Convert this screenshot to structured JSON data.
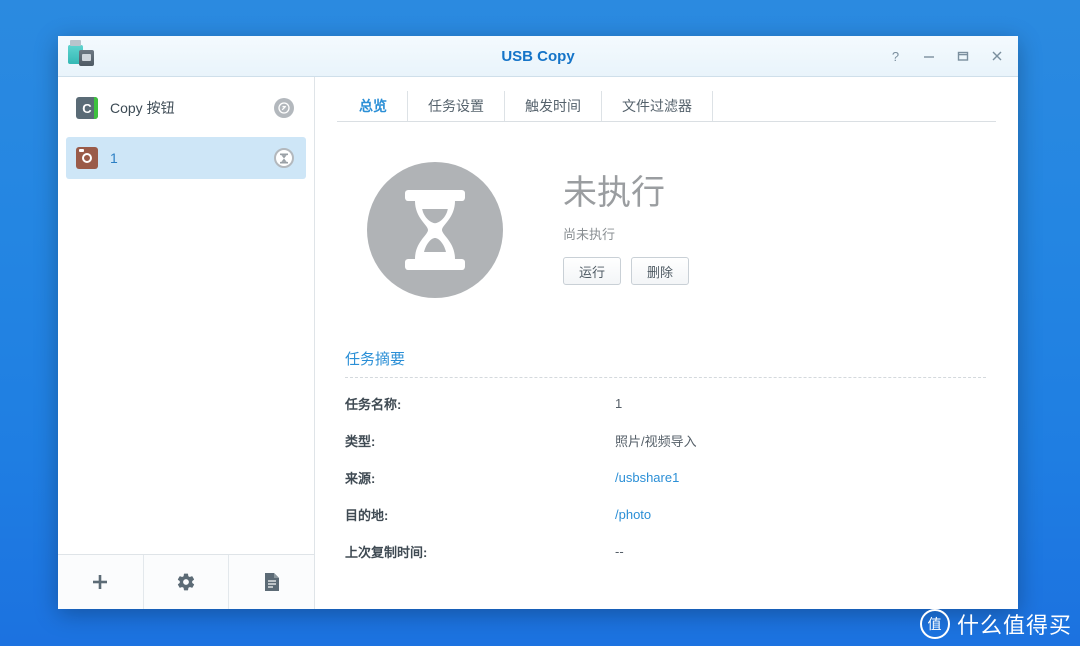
{
  "window": {
    "title": "USB Copy",
    "app_icon": "usb-sd-icon",
    "controls": [
      {
        "name": "help-button",
        "glyph": "?"
      },
      {
        "name": "minimize-button",
        "glyph": "minimize-icon"
      },
      {
        "name": "maximize-button",
        "glyph": "maximize-icon"
      },
      {
        "name": "close-button",
        "glyph": "close-icon"
      }
    ]
  },
  "sidebar": {
    "tasks": [
      {
        "label": "Copy 按钮",
        "icon": "copy-button-icon",
        "status_icon": "link-broken-icon",
        "selected": false
      },
      {
        "label": "1",
        "icon": "camera-icon",
        "status_icon": "hourglass-icon",
        "selected": true
      }
    ],
    "toolbar": [
      {
        "name": "add-task-button",
        "icon": "plus-icon"
      },
      {
        "name": "settings-button",
        "icon": "gear-icon"
      },
      {
        "name": "log-button",
        "icon": "document-icon"
      }
    ]
  },
  "main": {
    "tabs": [
      {
        "label": "总览",
        "active": true
      },
      {
        "label": "任务设置",
        "active": false
      },
      {
        "label": "触发时间",
        "active": false
      },
      {
        "label": "文件过滤器",
        "active": false
      }
    ],
    "status": {
      "icon": "hourglass-icon",
      "title": "未执行",
      "subtitle": "尚未执行",
      "run_label": "运行",
      "delete_label": "删除"
    },
    "summary": {
      "title": "任务摘要",
      "rows": [
        {
          "key": "任务名称:",
          "value": "1",
          "link": false
        },
        {
          "key": "类型:",
          "value": "照片/视频导入",
          "link": false
        },
        {
          "key": "来源:",
          "value": "/usbshare1",
          "link": true
        },
        {
          "key": "目的地:",
          "value": "/photo",
          "link": true
        },
        {
          "key": "上次复制时间:",
          "value": "--",
          "link": false
        }
      ]
    }
  },
  "watermark": {
    "badge": "值",
    "text": "什么值得买"
  },
  "colors": {
    "desktop_blue": "#2486e2",
    "accent_blue": "#2b8fd6",
    "title_blue": "#1574c8",
    "selected_row": "#cee6f7",
    "status_gray": "#b0b3b6"
  }
}
